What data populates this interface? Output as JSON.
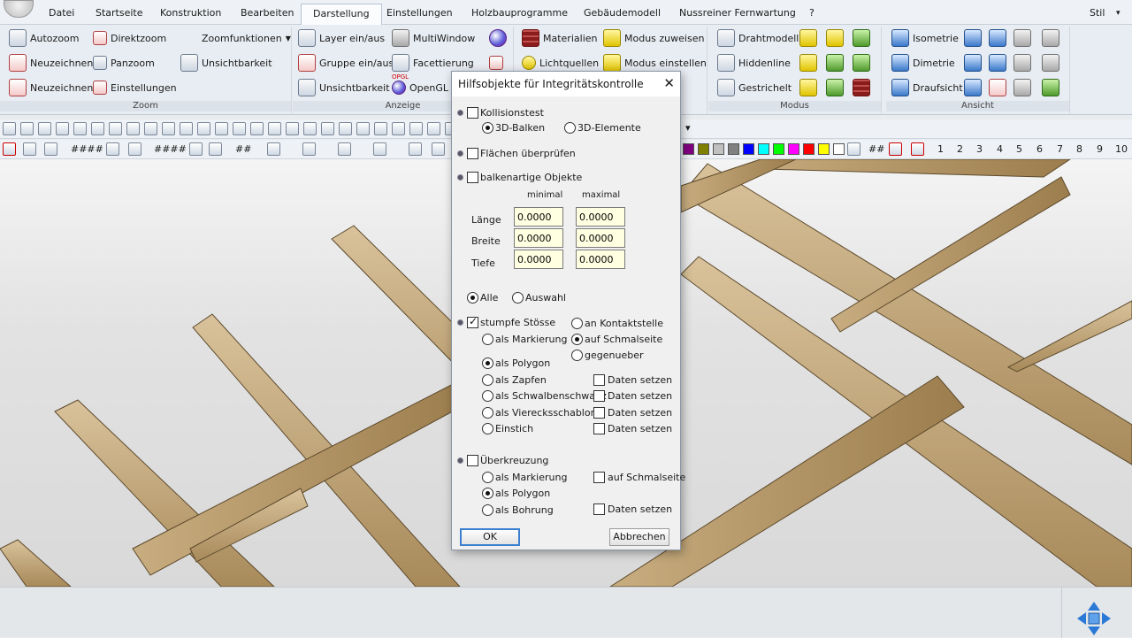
{
  "menubar": {
    "items": [
      "Datei",
      "Startseite",
      "Konstruktion",
      "Bearbeiten",
      "Darstellung",
      "Einstellungen",
      "Holzbauprogramme",
      "Gebäudemodell",
      "Nussreiner Fernwartung",
      "?"
    ],
    "active": "Darstellung",
    "right_label": "Stil"
  },
  "ribbon": {
    "zoom": {
      "label": "Zoom",
      "buttons": [
        "Autozoom",
        "Direktzoom",
        "Zoomfunktionen",
        "Neuzeichnen",
        "Panzoom",
        "Unsichtbarkeit",
        "Neuzeichnen",
        "Einstellungen"
      ]
    },
    "anzeige": {
      "label": "Anzeige",
      "buttons": [
        "Layer ein/aus",
        "MultiWindow",
        "Gruppe ein/aus",
        "Facettierung",
        "Unsichtbarkeit",
        "OpenGL"
      ],
      "opengl_icon_text": "OPGL"
    },
    "material": {
      "buttons": [
        "Materialien",
        "Modus zuweisen",
        "Lichtquellen",
        "Modus einstellen"
      ]
    },
    "modus": {
      "label": "Modus",
      "buttons": [
        "Drahtmodell",
        "Hiddenline",
        "Gestrichelt"
      ]
    },
    "ansicht": {
      "label": "Ansicht",
      "buttons": [
        "Isometrie",
        "Dimetrie",
        "Draufsicht"
      ]
    }
  },
  "toolbar2": {
    "hash_groups": [
      "####",
      "####",
      "##"
    ]
  },
  "toolbar3": {
    "hash_groups": [
      "####",
      "####",
      "##"
    ],
    "right_hash": "##",
    "numbers": [
      "1",
      "2",
      "3",
      "4",
      "5",
      "6",
      "7",
      "8",
      "9",
      "10"
    ],
    "color_swatches": [
      "#800080",
      "#808000",
      "#c0c0c0",
      "#808080",
      "#0000ff",
      "#00ffff",
      "#00ff00",
      "#ff00ff",
      "#ff0000",
      "#ffff00",
      "#ffffff"
    ]
  },
  "dialog": {
    "title": "Hilfsobjekte für Integritätskontrolle",
    "kollisionstest": {
      "label": "Kollisionstest",
      "checked": false
    },
    "mode_3d_balken": {
      "label": "3D-Balken",
      "selected": true
    },
    "mode_3d_elemente": {
      "label": "3D-Elemente",
      "selected": false
    },
    "flaechen": {
      "label": "Flächen überprüfen",
      "checked": false
    },
    "balkenartige": {
      "label": "balkenartige Objekte",
      "checked": false
    },
    "col_min": "minimal",
    "col_max": "maximal",
    "laenge": {
      "label": "Länge",
      "min": "0.0000",
      "max": "0.0000"
    },
    "breite": {
      "label": "Breite",
      "min": "0.0000",
      "max": "0.0000"
    },
    "tiefe": {
      "label": "Tiefe",
      "min": "0.0000",
      "max": "0.0000"
    },
    "alle": {
      "label": "Alle",
      "selected": true
    },
    "auswahl": {
      "label": "Auswahl",
      "selected": false
    },
    "stumpfe": {
      "label": "stumpfe Stösse",
      "checked": true
    },
    "an_kontaktstelle": "an Kontaktstelle",
    "auf_schmalseite": "auf Schmalseite",
    "gegenueber": "gegenueber",
    "als_markierung": "als Markierung",
    "als_polygon": "als Polygon",
    "als_zapfen": "als Zapfen",
    "als_schwalbenschwanz": "als Schwalbenschwanz",
    "als_vierecksschablone": "als Vierecksschablone",
    "einstich": "Einstich",
    "daten_setzen": "Daten setzen",
    "ueberkreuzung": {
      "label": "Überkreuzung",
      "checked": false
    },
    "ue_als_markierung": "als Markierung",
    "ue_als_polygon": "als Polygon",
    "ue_als_bohrung": "als Bohrung",
    "ue_auf_schmalseite": "auf Schmalseite",
    "ue_daten_setzen": "Daten setzen",
    "ok": "OK",
    "abbrechen": "Abbrechen"
  }
}
